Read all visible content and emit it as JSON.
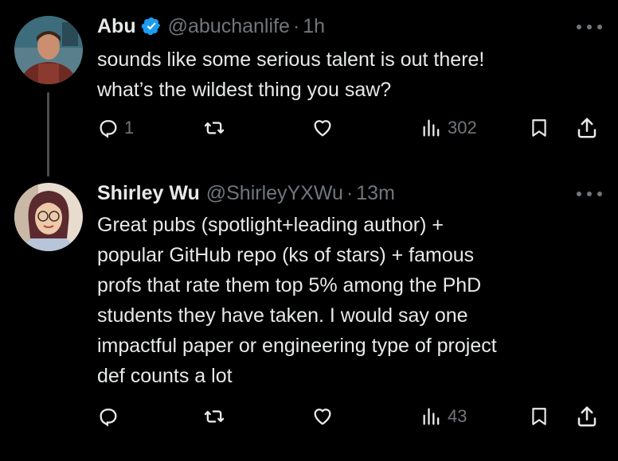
{
  "tweets": [
    {
      "name": "Abu",
      "verified": true,
      "handle": "@abuchanlife",
      "separator": "·",
      "time": "1h",
      "text": "sounds like some serious talent is out there!\nwhat’s the wildest thing you saw?",
      "replies": "1",
      "retweets": "",
      "likes": "",
      "views": "302"
    },
    {
      "name": "Shirley Wu",
      "verified": false,
      "handle": "@ShirleyYXWu",
      "separator": "·",
      "time": "13m",
      "text": "Great pubs (spotlight+leading author) +\npopular GitHub repo (ks of stars) + famous\nprofs that rate them top 5% among the PhD\nstudents they have taken. I would say one\nimpactful paper or engineering type of project\ndef counts a lot",
      "replies": "",
      "retweets": "",
      "likes": "",
      "views": "43"
    }
  ],
  "colors": {
    "background": "#000000",
    "text": "#e7e9ea",
    "muted": "#71767b",
    "verified": "#1d9bf0",
    "thread_line": "#4a4d50"
  }
}
